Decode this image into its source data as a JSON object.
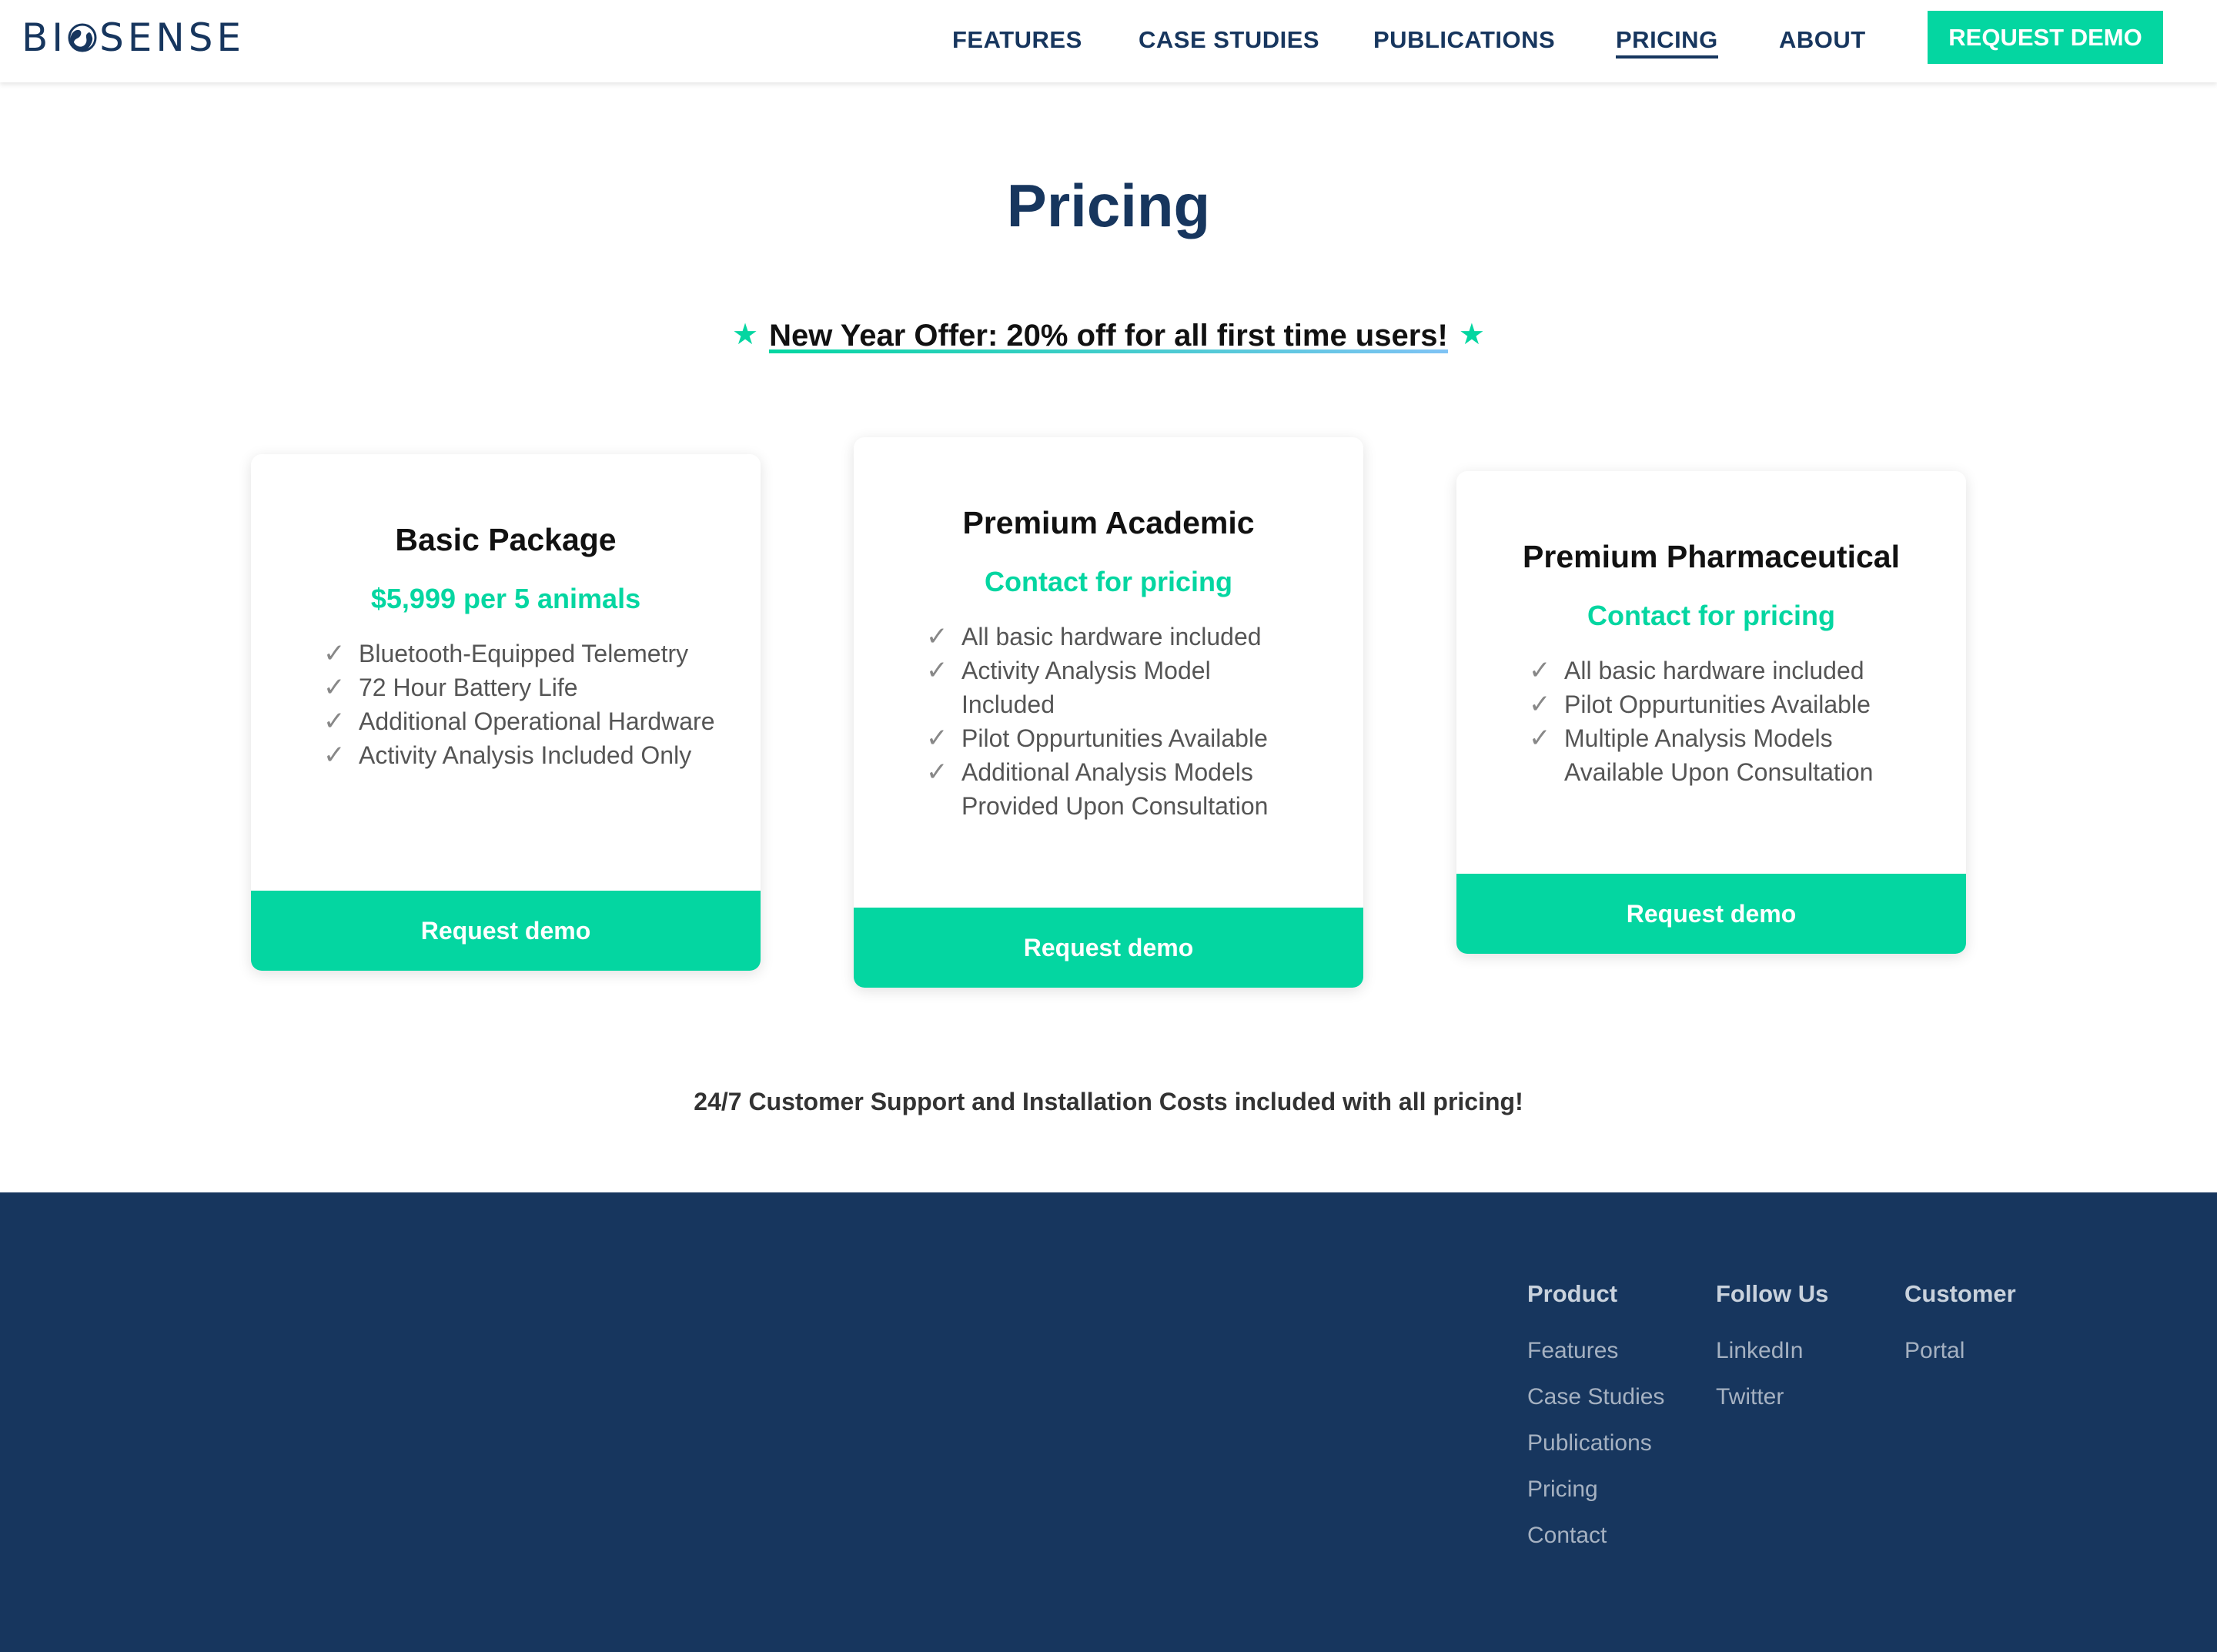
{
  "header": {
    "logo": "BIOSENSE",
    "nav": [
      "FEATURES",
      "CASE STUDIES",
      "PUBLICATIONS",
      "PRICING",
      "ABOUT"
    ],
    "active_nav": "PRICING",
    "demo_button": "REQUEST DEMO"
  },
  "main": {
    "title": "Pricing",
    "offer": "New Year Offer: 20% off for all first time users!",
    "cards": [
      {
        "title": "Basic Package",
        "price": "$5,999 per 5 animals",
        "features": [
          "Bluetooth-Equipped Telemetry",
          "72 Hour Battery Life",
          "Additional Operational Hardware",
          "Activity Analysis Included Only"
        ],
        "button": "Request demo"
      },
      {
        "title": "Premium Academic",
        "price": "Contact for pricing",
        "features": [
          "All basic hardware included",
          "Activity Analysis Model Included",
          "Pilot Oppurtunities Available",
          "Additional Analysis Models Provided Upon Consultation"
        ],
        "button": "Request demo"
      },
      {
        "title": "Premium Pharmaceutical",
        "price": "Contact for pricing",
        "features": [
          "All basic hardware included",
          "Pilot Oppurtunities Available",
          "Multiple Analysis Models Available Upon Consultation"
        ],
        "button": "Request demo"
      }
    ],
    "support_note": "24/7 Customer Support and Installation Costs included with all pricing!"
  },
  "footer": {
    "columns": [
      {
        "heading": "Product",
        "links": [
          "Features",
          "Case Studies",
          "Publications",
          "Pricing",
          "Contact"
        ]
      },
      {
        "heading": "Follow Us",
        "links": [
          "LinkedIn",
          "Twitter"
        ]
      },
      {
        "heading": "Customer",
        "links": [
          "Portal"
        ]
      }
    ]
  },
  "colors": {
    "brand_navy": "#17365e",
    "accent_green": "#04d6a1"
  },
  "icons": [
    "globe-logo-icon",
    "star-icon",
    "checkmark-icon"
  ]
}
